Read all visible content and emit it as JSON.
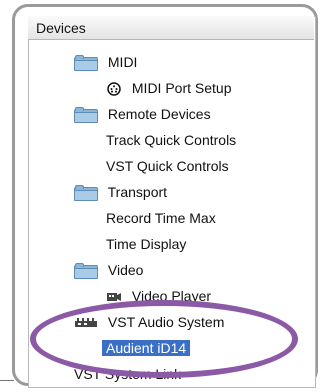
{
  "panel": {
    "title": "Devices"
  },
  "items": [
    {
      "label": "MIDI",
      "icon": "folder-icon"
    },
    {
      "label": "MIDI Port Setup",
      "icon": "midi-port-icon"
    },
    {
      "label": "Remote Devices",
      "icon": "folder-icon"
    },
    {
      "label": "Track Quick Controls",
      "icon": "none"
    },
    {
      "label": "VST Quick Controls",
      "icon": "none"
    },
    {
      "label": "Transport",
      "icon": "folder-icon"
    },
    {
      "label": "Record Time Max",
      "icon": "none"
    },
    {
      "label": "Time Display",
      "icon": "none"
    },
    {
      "label": "Video",
      "icon": "folder-icon"
    },
    {
      "label": "Video Player",
      "icon": "video-player-icon"
    },
    {
      "label": "VST Audio System",
      "icon": "audio-device-icon"
    },
    {
      "label": "Audient iD14",
      "icon": "none",
      "selected": true
    },
    {
      "label": "VST System Link",
      "icon": "none"
    }
  ],
  "colors": {
    "selection": "#3b6fc6",
    "highlight_ellipse": "#8b59a6",
    "folder": "#8bb6d9"
  }
}
